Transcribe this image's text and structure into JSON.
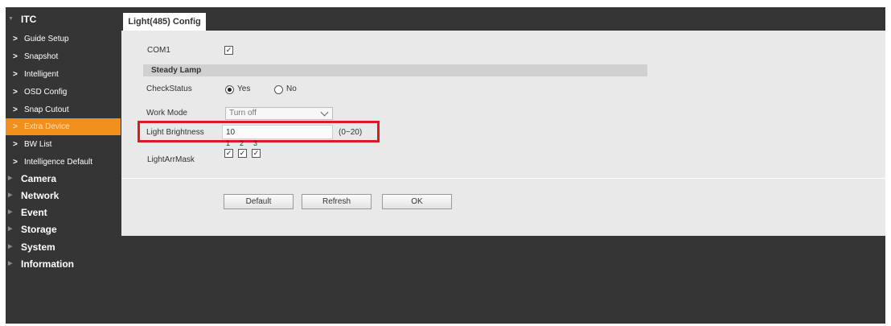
{
  "sidebar": {
    "itc_label": "ITC",
    "items": [
      {
        "label": "Guide Setup"
      },
      {
        "label": "Snapshot"
      },
      {
        "label": "Intelligent"
      },
      {
        "label": "OSD Config"
      },
      {
        "label": "Snap Cutout"
      },
      {
        "label": "Extra Device",
        "active": true
      },
      {
        "label": "BW List"
      },
      {
        "label": "Intelligence Default"
      }
    ],
    "groups": [
      {
        "label": "Camera"
      },
      {
        "label": "Network"
      },
      {
        "label": "Event"
      },
      {
        "label": "Storage"
      },
      {
        "label": "System"
      },
      {
        "label": "Information"
      }
    ]
  },
  "tab": {
    "label": "Light(485) Config"
  },
  "form": {
    "com1": {
      "label": "COM1",
      "checked": true
    },
    "section_title": "Steady Lamp",
    "check_status": {
      "label": "CheckStatus",
      "yes": "Yes",
      "no": "No",
      "selected": "Yes"
    },
    "work_mode": {
      "label": "Work Mode",
      "value": "Turn off"
    },
    "brightness": {
      "label": "Light Brightness",
      "value": "10",
      "range": "(0~20)"
    },
    "mask": {
      "label": "LightArrMask",
      "numbers": [
        "1",
        "2",
        "3"
      ],
      "checked": [
        true,
        true,
        true
      ]
    }
  },
  "buttons": {
    "default": "Default",
    "refresh": "Refresh",
    "ok": "OK"
  },
  "colors": {
    "active_item": "#f28e1c",
    "highlight": "#e0191f",
    "background": "#353535"
  }
}
